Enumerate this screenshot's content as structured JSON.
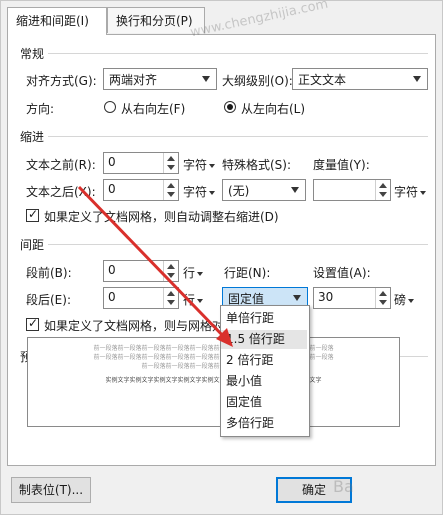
{
  "tabs": [
    {
      "label": "缩进和间距(I)",
      "active": true
    },
    {
      "label": "换行和分页(P)",
      "active": false
    }
  ],
  "general": {
    "title": "常规",
    "alignment_label": "对齐方式(G):",
    "alignment_value": "两端对齐",
    "outline_label": "大纲级别(O):",
    "outline_value": "正文文本",
    "direction_label": "方向:",
    "rtl_label": "从右向左(F)",
    "ltr_label": "从左向右(L)",
    "ltr_checked": true
  },
  "indent": {
    "title": "缩进",
    "before_label": "文本之前(R):",
    "before_value": "0",
    "before_unit": "字符",
    "after_label": "文本之后(X):",
    "after_value": "0",
    "after_unit": "字符",
    "special_label": "特殊格式(S):",
    "special_value": "(无)",
    "measure_label": "度量值(Y):",
    "measure_value": "",
    "measure_unit": "字符",
    "auto_adjust_label": "如果定义了文档网格，则自动调整右缩进(D)",
    "auto_adjust_checked": true
  },
  "spacing": {
    "title": "间距",
    "before_label": "段前(B):",
    "before_value": "0",
    "before_unit": "行",
    "after_label": "段后(E):",
    "after_value": "0",
    "after_unit": "行",
    "line_label": "行距(N):",
    "line_value": "固定值",
    "setting_label": "设置值(A):",
    "setting_value": "30",
    "setting_unit": "磅",
    "grid_align_label": "如果定义了文档网格，则与网格对齐",
    "grid_align_checked": true
  },
  "preview": {
    "title": "预览",
    "gray_line": "前一段落前一段落前一段落前一段落前一段落前一段落前一段落前一段落前一段落前一段落",
    "gray_line_short": "前一段落前一段落前一段落前一段落前一段落前一段落",
    "sample_line": "实例文字实例文字实例文字实例文字实例文字实例文字实例文字实例文字实例文字"
  },
  "line_spacing_options": [
    {
      "label": "单倍行距",
      "selected": false
    },
    {
      "label": "1.5 倍行距",
      "selected": true
    },
    {
      "label": "2 倍行距",
      "selected": false
    },
    {
      "label": "最小值",
      "selected": false
    },
    {
      "label": "固定值",
      "selected": false
    },
    {
      "label": "多倍行距",
      "selected": false
    }
  ],
  "buttons": {
    "tabs_label": "制表位(T)...",
    "ok_label": "确定"
  },
  "watermark": {
    "text": "www.chengzhijia.com",
    "corner_text": "Ba"
  },
  "colors": {
    "accent": "#0078d7",
    "annotation_arrow": "#d9302c",
    "focus_bg": "#cce4f7"
  }
}
